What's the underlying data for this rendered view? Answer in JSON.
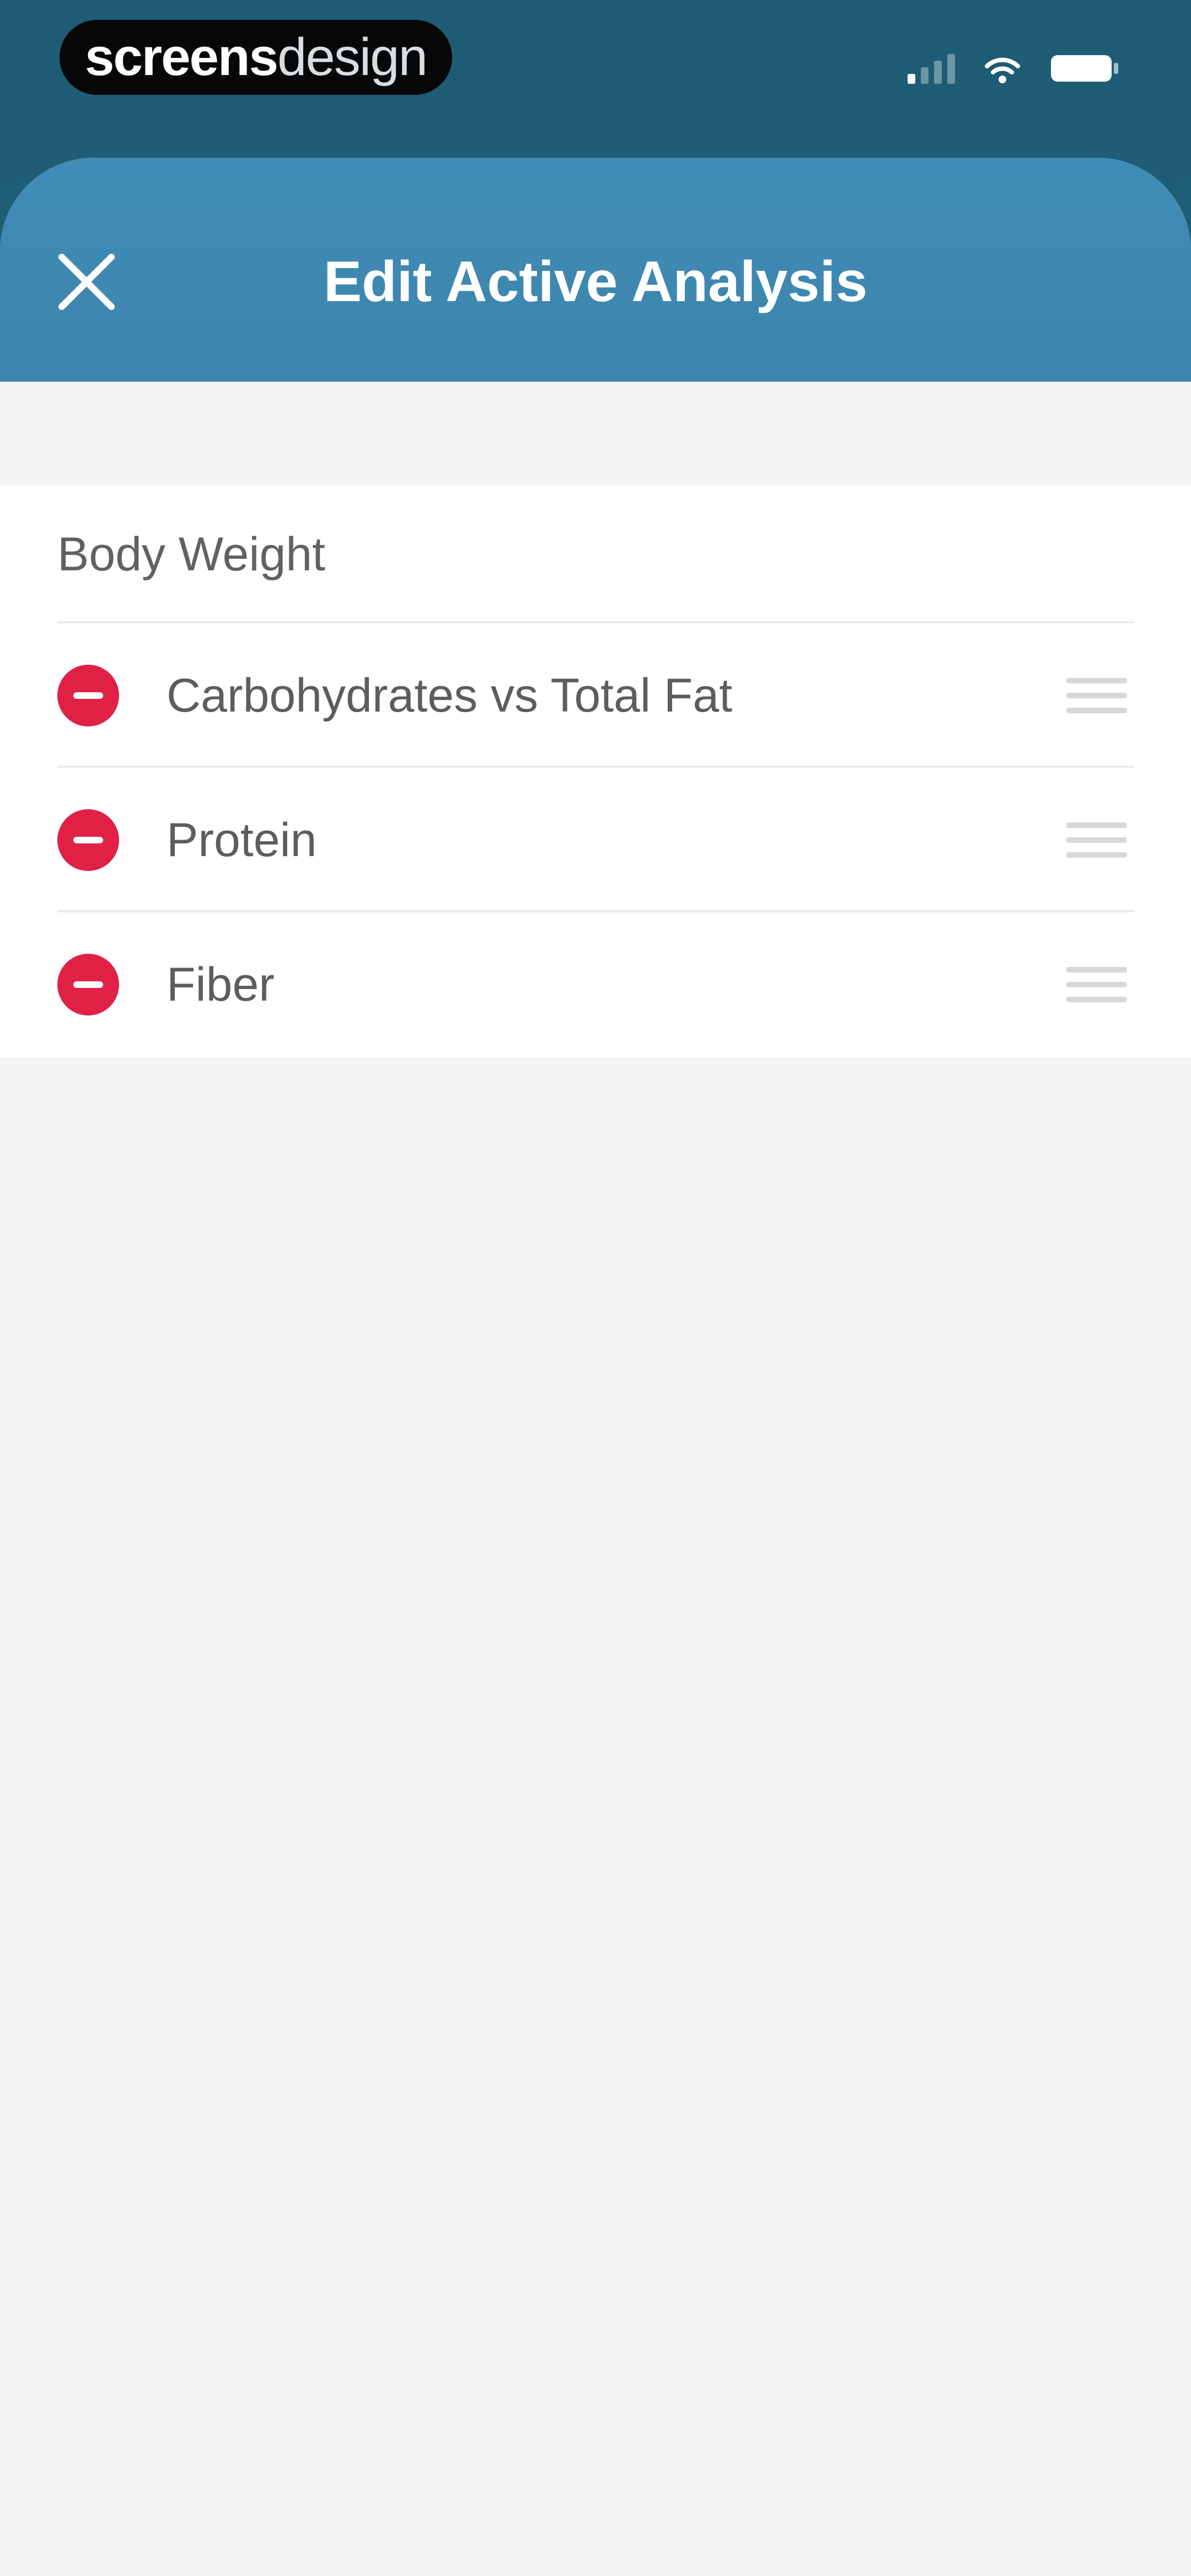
{
  "status_bar": {
    "watermark_bold": "screens",
    "watermark_light": "design"
  },
  "header": {
    "title": "Edit Active Analysis",
    "close_icon": "close-icon"
  },
  "list": {
    "fixed_item": "Body Weight",
    "items": [
      {
        "label": "Carbohydrates vs Total Fat"
      },
      {
        "label": "Protein"
      },
      {
        "label": "Fiber"
      }
    ]
  },
  "colors": {
    "header_blue": "#3f8db7",
    "delete_red": "#e02146",
    "background": "#f5f5f5"
  }
}
